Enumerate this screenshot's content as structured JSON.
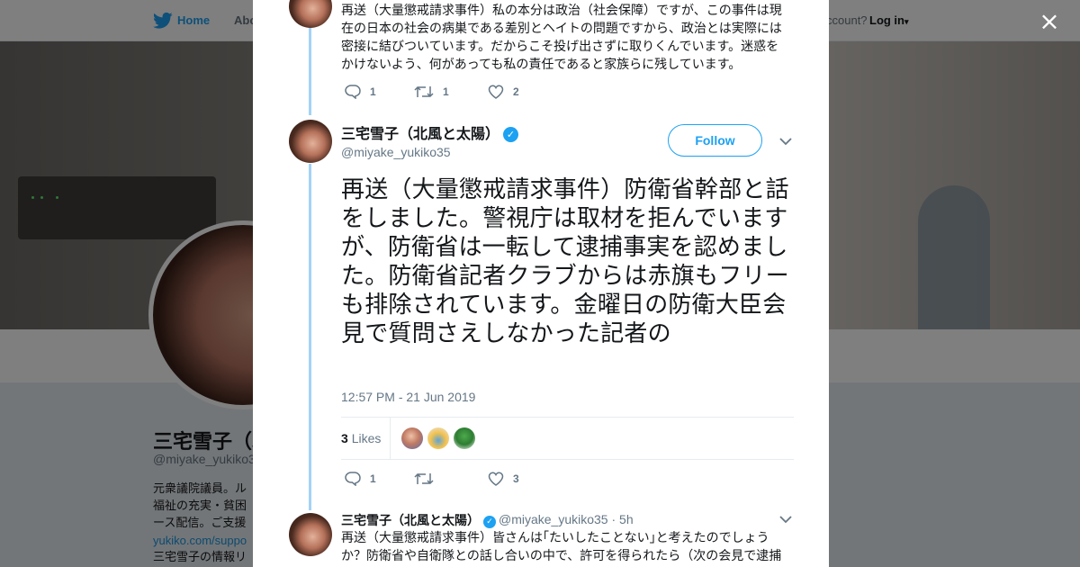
{
  "nav": {
    "home": "Home",
    "about": "Abo",
    "account_prompt": "ccount?",
    "login": "Log in",
    "caret": "▾"
  },
  "profile": {
    "name": "三宅雪子（北",
    "handle": "@miyake_yukiko3",
    "bio_lines": [
      "元衆議院議員。ル",
      "福祉の充実・貧困",
      "ース配信。ご支援"
    ],
    "bio_link": "yukiko.com/suppo",
    "bio_tail": "三宅雪子の情報リ"
  },
  "close_label": "×",
  "modal": {
    "previous_tweet": {
      "text": "再送（大量懲戒請求事件）私の本分は政治（社会保障）ですが、この事件は現在の日本の社会の病巣である差別とヘイトの問題ですから、政治とは実際には密接に結びついています。だからこそ投げ出さずに取りくんでいます。迷惑をかけないよう、何があっても私の責任であると家族らに残しています。",
      "replies": "1",
      "retweets": "1",
      "likes": "2"
    },
    "main_tweet": {
      "name": "三宅雪子（北風と太陽）",
      "handle": "@miyake_yukiko35",
      "follow_label": "Follow",
      "text": "再送（大量懲戒請求事件）防衛省幹部と話をしました。警視庁は取材を拒んでいますが、防衛省は一転して逮捕事実を認めました。防衛省記者クラブからは赤旗もフリーも排除されています。金曜日の防衛大臣会見で質問さえしなかった記者の",
      "timestamp": "12:57 PM - 21 Jun 2019",
      "likes_count": "3",
      "likes_label": "Likes",
      "replies": "1",
      "retweets": "",
      "likes": "3"
    },
    "reply_tweet": {
      "name": "三宅雪子（北風と太陽）",
      "handle": "@miyake_yukiko35",
      "time": "· 5h",
      "text": "再送（大量懲戒請求事件）皆さんは｢たいしたことない｣と考えたのでしょうか？防衛省や自衛隊との話し合いの中で、許可を得られたら（次の会見で逮捕"
    }
  },
  "colors": {
    "accent": "#1da1f2",
    "thread_line": "#a3d3f5",
    "muted_text": "#657786"
  }
}
